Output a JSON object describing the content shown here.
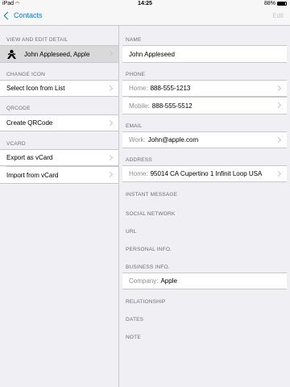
{
  "status": {
    "carrier": "iPad",
    "time": "14:25",
    "battery": "88%",
    "battery_level": 0.88
  },
  "nav": {
    "back_label": "Contacts",
    "edit_label": "Edit"
  },
  "left": {
    "sections": [
      {
        "header": "VIEW AND EDIT DETAIL",
        "items": [
          "John Appleseed, Apple"
        ]
      },
      {
        "header": "CHANGE ICON",
        "items": [
          "Select Icon from List"
        ]
      },
      {
        "header": "QRCODE",
        "items": [
          "Create QRCode"
        ]
      },
      {
        "header": "VCARD",
        "items": [
          "Export as vCard",
          "Import from vCard"
        ]
      }
    ]
  },
  "right": {
    "name_header": "NAME",
    "name_value": "John Appleseed",
    "phone_header": "PHONE",
    "phones": [
      {
        "label": "Home:",
        "value": "888-555-1213"
      },
      {
        "label": "Mobile:",
        "value": "888-555-5512"
      }
    ],
    "email_header": "EMAIL",
    "email": {
      "label": "Work:",
      "value": "John@apple.com"
    },
    "address_header": "ADDRESS",
    "address": {
      "label": "Home:",
      "value": "95014 CA Cupertino 1 Infinit Loop USA"
    },
    "empty_headers": [
      "INSTANT MESSAGE",
      "SOCIAL NETWORK",
      "URL",
      "PERSONAL INFO."
    ],
    "business_header": "BUSINESS INFO.",
    "company": {
      "label": "Company:",
      "value": "Apple"
    },
    "tail_headers": [
      "RELATIONSHIP",
      "DATES",
      "NOTE"
    ]
  }
}
